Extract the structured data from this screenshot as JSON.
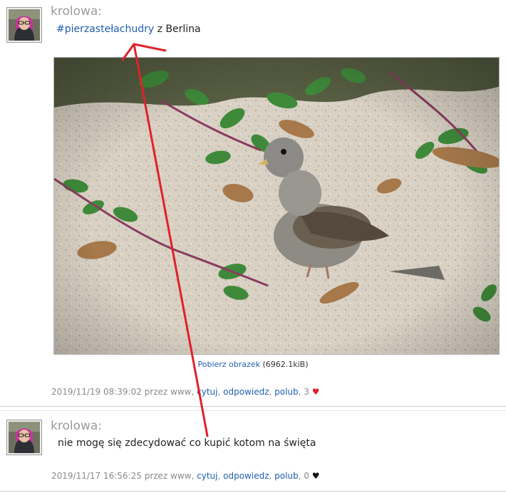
{
  "posts": [
    {
      "author": "krolowa:",
      "hashtag": "#pierzastełachudry",
      "text_after": " z Berlina",
      "download_label": "Pobierz obrazek",
      "download_size": "(6962.1kiB)",
      "meta": {
        "timestamp": "2019/11/19 08:39:02",
        "via": "przez www,",
        "cite": "cytuj",
        "reply": "odpowiedz",
        "like": "polub",
        "count": "3",
        "heart": "♥"
      }
    },
    {
      "author": "krolowa:",
      "text": "nie mogę się zdecydować co kupić kotom na święta",
      "meta": {
        "timestamp": "2019/11/17 16:56:25",
        "via": "przez www,",
        "cite": "cytuj",
        "reply": "odpowiedz",
        "like": "polub",
        "count": "0",
        "heart": "♥"
      }
    }
  ],
  "colors": {
    "link": "#1f5fb0",
    "heart_liked": "#e0212b",
    "annotation_arrow": "#e0212b"
  },
  "icons": [
    "avatar",
    "heart-icon",
    "sparrow-photo",
    "red-arrow-annotation"
  ]
}
